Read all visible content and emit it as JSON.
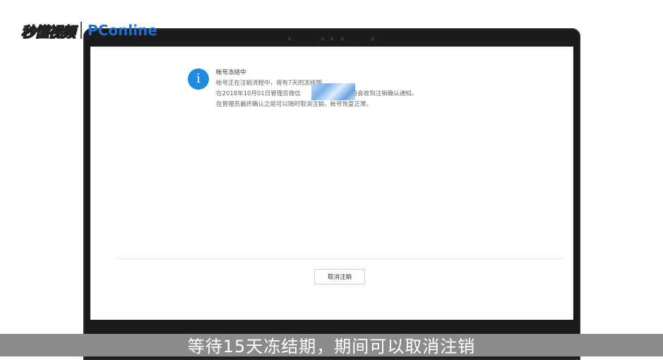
{
  "watermark": {
    "brand_cn": "秒懂视频",
    "brand_en": "PConline"
  },
  "notice": {
    "icon": "info-icon",
    "title": "帐号冻结中",
    "lines": [
      "帐号正在注销流程中，将有7天的冻结期",
      "在2018年10月01日管理员微信",
      "将会收到注销确认通知。",
      "在管理员最终确认之前可以随时取消注销，帐号恢复正常。"
    ]
  },
  "actions": {
    "cancel_label": "取消注销"
  },
  "subtitle": "等待15天冻结期，期间可以取消注销",
  "colors": {
    "accent": "#1e8be0",
    "bezel": "#1b1b1b",
    "caption_bar": "#8b8b8b"
  }
}
